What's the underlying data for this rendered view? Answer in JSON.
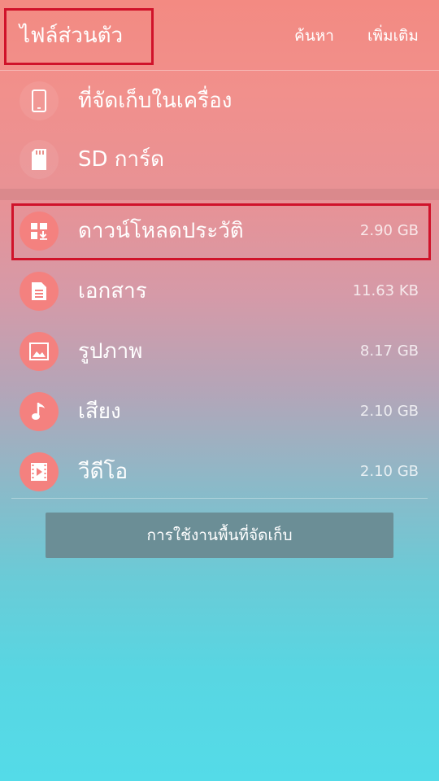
{
  "header": {
    "title": "ไฟล์ส่วนตัว",
    "search_label": "ค้นหา",
    "more_label": "เพิ่มเติม"
  },
  "storage": {
    "internal_label": "ที่จัดเก็บในเครื่อง",
    "sd_label": "SD การ์ด"
  },
  "categories": [
    {
      "label": "ดาวน์โหลดประวัติ",
      "size": "2.90 GB",
      "icon": "download-icon"
    },
    {
      "label": "เอกสาร",
      "size": "11.63 KB",
      "icon": "document-icon"
    },
    {
      "label": "รูปภาพ",
      "size": "8.17 GB",
      "icon": "image-icon"
    },
    {
      "label": "เสียง",
      "size": "2.10 GB",
      "icon": "music-note-icon"
    },
    {
      "label": "วีดีโอ",
      "size": "2.10 GB",
      "icon": "video-icon"
    }
  ],
  "footer": {
    "usage_button_label": "การใช้งานพื้นที่จัดเก็บ"
  },
  "colors": {
    "highlight_border": "#d0122a",
    "category_icon_bg": "#f4817f",
    "usage_button_bg": "#6b8e96"
  }
}
